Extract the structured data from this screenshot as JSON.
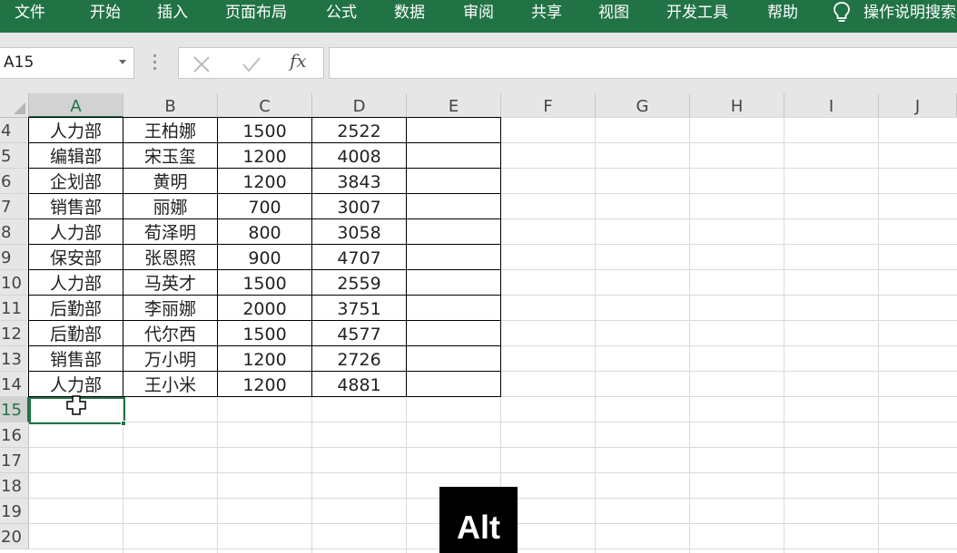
{
  "menu": {
    "tabs": [
      "文件",
      "开始",
      "插入",
      "页面布局",
      "公式",
      "数据",
      "审阅",
      "共享",
      "视图",
      "开发工具",
      "帮助"
    ],
    "tell_me": "操作说明搜索",
    "tell_me_icon": "lightbulb-icon"
  },
  "formula_bar": {
    "name_box": "A15",
    "cancel_icon": "cancel-x-icon",
    "enter_icon": "enter-check-icon",
    "fx_label": "fx",
    "formula_value": ""
  },
  "sheet": {
    "columns": [
      "A",
      "B",
      "C",
      "D",
      "E",
      "F",
      "G",
      "H",
      "I",
      "J"
    ],
    "row_numbers": [
      "4",
      "5",
      "6",
      "7",
      "8",
      "9",
      "10",
      "11",
      "12",
      "13",
      "14",
      "15",
      "16",
      "17",
      "18",
      "19",
      "20"
    ],
    "selected_cell": "A15",
    "data_rows": [
      [
        "人力部",
        "王柏娜",
        "1500",
        "2522"
      ],
      [
        "编辑部",
        "宋玉玺",
        "1200",
        "4008"
      ],
      [
        "企划部",
        "黄明",
        "1200",
        "3843"
      ],
      [
        "销售部",
        "丽娜",
        "700",
        "3007"
      ],
      [
        "人力部",
        "荀泽明",
        "800",
        "3058"
      ],
      [
        "保安部",
        "张恩照",
        "900",
        "4707"
      ],
      [
        "人力部",
        "马英才",
        "1500",
        "2559"
      ],
      [
        "后勤部",
        "李丽娜",
        "2000",
        "3751"
      ],
      [
        "后勤部",
        "代尔西",
        "1500",
        "4577"
      ],
      [
        "销售部",
        "万小明",
        "1200",
        "2726"
      ],
      [
        "人力部",
        "王小米",
        "1200",
        "4881"
      ]
    ]
  },
  "key_overlay": {
    "label": "Alt"
  },
  "colors": {
    "ribbon_green": "#217346",
    "header_gray": "#e6e6e6",
    "gridline": "#dadada"
  }
}
